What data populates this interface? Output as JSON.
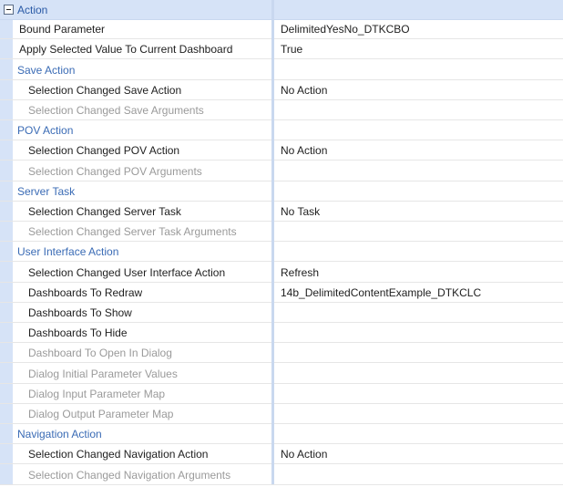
{
  "grid": {
    "category": "Action",
    "rows": [
      {
        "kind": "prop",
        "label": "Bound Parameter",
        "value": "DelimitedYesNo_DTKCBO"
      },
      {
        "kind": "prop",
        "label": "Apply Selected Value To Current Dashboard",
        "value": "True"
      },
      {
        "kind": "section",
        "label": "Save Action"
      },
      {
        "kind": "prop",
        "label": "Selection Changed Save Action",
        "value": "No Action",
        "indent": true
      },
      {
        "kind": "prop",
        "label": "Selection Changed Save Arguments",
        "value": "",
        "indent": true,
        "disabled": true
      },
      {
        "kind": "section",
        "label": "POV Action"
      },
      {
        "kind": "prop",
        "label": "Selection Changed POV Action",
        "value": "No Action",
        "indent": true
      },
      {
        "kind": "prop",
        "label": "Selection Changed POV Arguments",
        "value": "",
        "indent": true,
        "disabled": true
      },
      {
        "kind": "section",
        "label": "Server Task"
      },
      {
        "kind": "prop",
        "label": "Selection Changed Server Task",
        "value": "No Task",
        "indent": true
      },
      {
        "kind": "prop",
        "label": "Selection Changed Server Task Arguments",
        "value": "",
        "indent": true,
        "disabled": true
      },
      {
        "kind": "section",
        "label": "User Interface Action"
      },
      {
        "kind": "prop",
        "label": "Selection Changed User Interface Action",
        "value": "Refresh",
        "indent": true
      },
      {
        "kind": "prop",
        "label": "Dashboards To Redraw",
        "value": "14b_DelimitedContentExample_DTKCLC",
        "indent": true
      },
      {
        "kind": "prop",
        "label": "Dashboards To Show",
        "value": "",
        "indent": true
      },
      {
        "kind": "prop",
        "label": "Dashboards To Hide",
        "value": "",
        "indent": true
      },
      {
        "kind": "prop",
        "label": "Dashboard To Open In Dialog",
        "value": "",
        "indent": true,
        "disabled": true
      },
      {
        "kind": "prop",
        "label": "Dialog Initial Parameter Values",
        "value": "",
        "indent": true,
        "disabled": true
      },
      {
        "kind": "prop",
        "label": "Dialog Input Parameter Map",
        "value": "",
        "indent": true,
        "disabled": true
      },
      {
        "kind": "prop",
        "label": "Dialog Output Parameter Map",
        "value": "",
        "indent": true,
        "disabled": true
      },
      {
        "kind": "section",
        "label": "Navigation Action"
      },
      {
        "kind": "prop",
        "label": "Selection Changed Navigation Action",
        "value": "No Action",
        "indent": true
      },
      {
        "kind": "prop",
        "label": "Selection Changed Navigation Arguments",
        "value": "",
        "indent": true,
        "disabled": true
      }
    ]
  }
}
